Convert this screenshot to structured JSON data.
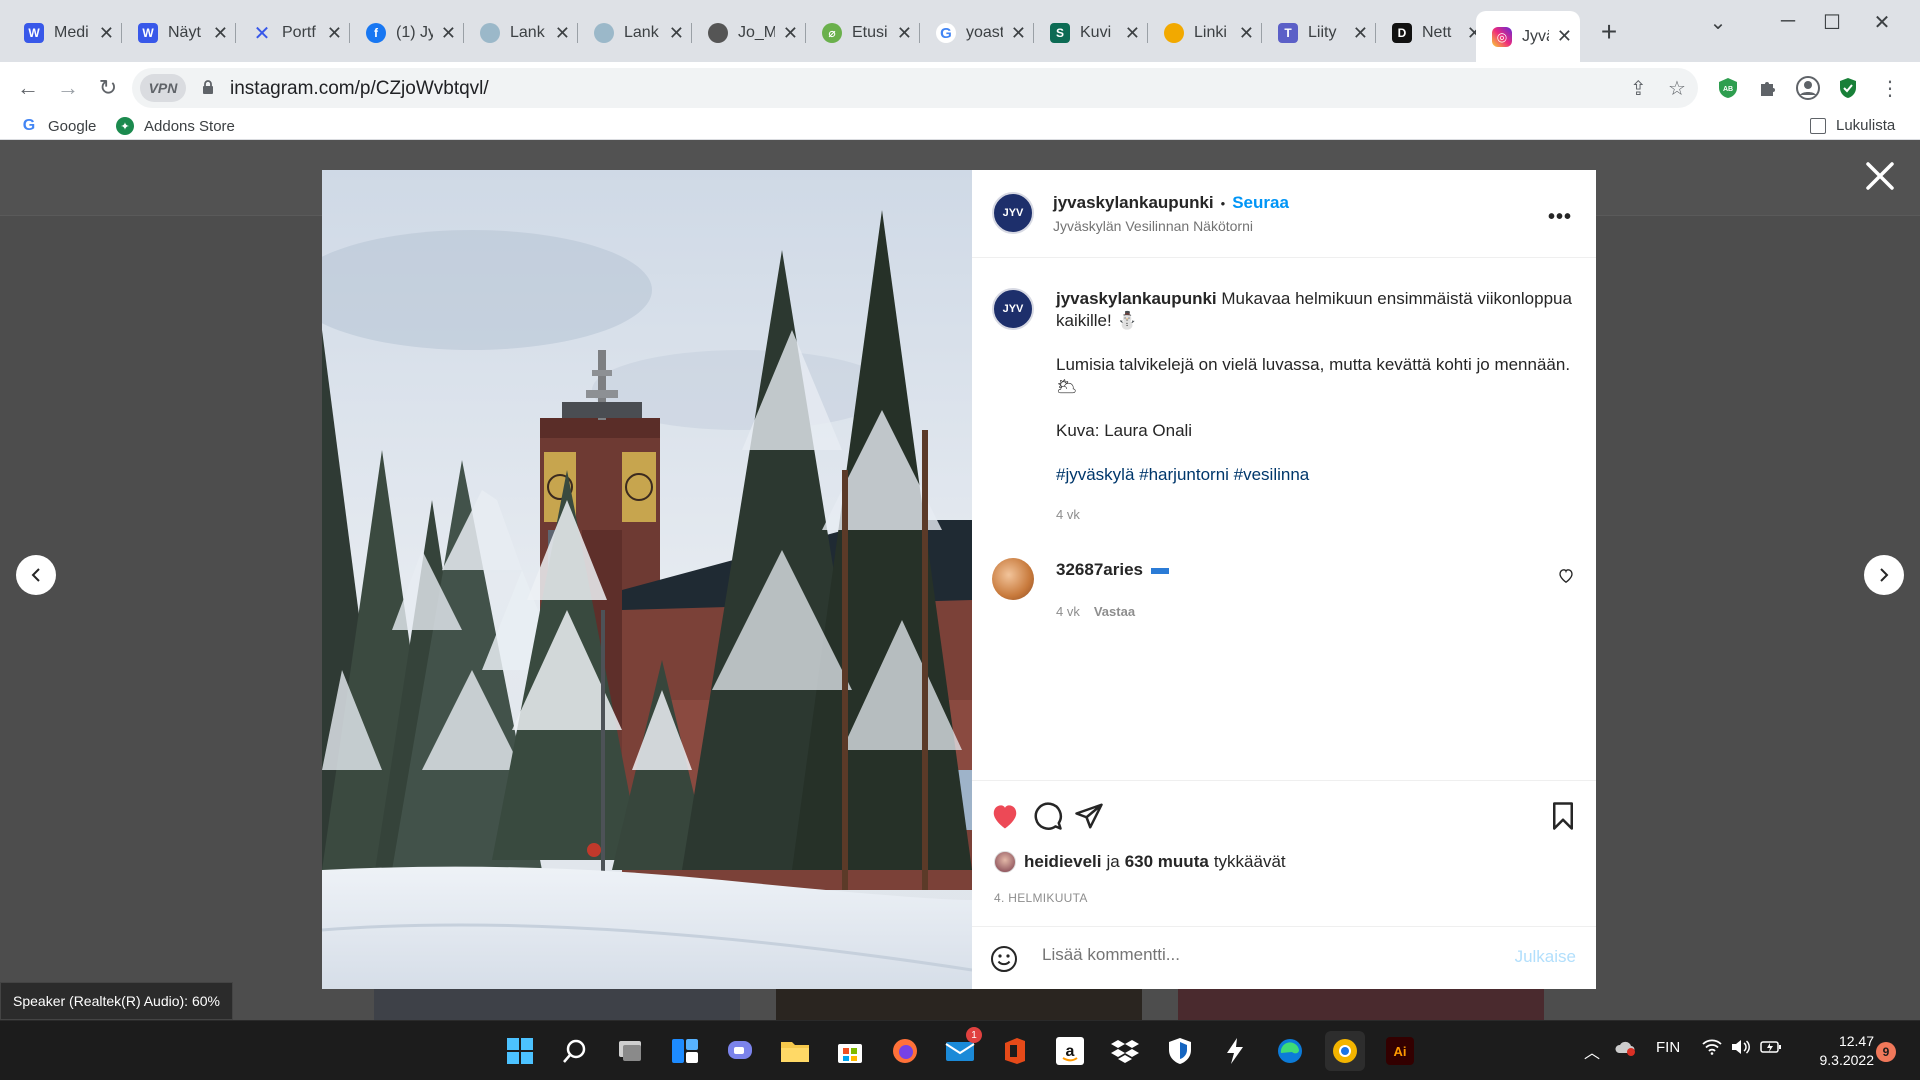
{
  "browser": {
    "tabs": [
      {
        "title": "Medi",
        "icon": "wordpress-icon",
        "color": "#3858e9"
      },
      {
        "title": "Näyt",
        "icon": "wordpress-icon",
        "color": "#3858e9"
      },
      {
        "title": "Portf",
        "icon": "x-logo-icon",
        "color": "#3858e9"
      },
      {
        "title": "(1) Jy",
        "icon": "facebook-icon",
        "color": "#1877f2"
      },
      {
        "title": "Lank",
        "icon": "globe-icon",
        "color": "#7aa874"
      },
      {
        "title": "Lank",
        "icon": "globe-icon",
        "color": "#7aa874"
      },
      {
        "title": "Jo_M",
        "icon": "avatar-icon",
        "color": "#444444"
      },
      {
        "title": "Etusi",
        "icon": "leaf-icon",
        "color": "#6ab04c"
      },
      {
        "title": "yoast",
        "icon": "google-icon",
        "color": "#4285f4"
      },
      {
        "title": "Kuvi",
        "icon": "s-logo-icon",
        "color": "#0c6b54"
      },
      {
        "title": "Linki",
        "icon": "link-icon",
        "color": "#f2a900"
      },
      {
        "title": "Liity",
        "icon": "teams-icon",
        "color": "#5b5fc7"
      },
      {
        "title": "Nett",
        "icon": "d-logo-icon",
        "color": "#111111"
      },
      {
        "title": "Jyväs",
        "icon": "instagram-icon",
        "color": "#d6249f",
        "active": true
      }
    ],
    "url": "instagram.com/p/CZjoWvbtqvl/",
    "vpn_label": "VPN",
    "bookmarks": [
      {
        "label": "Google",
        "icon": "google-icon"
      },
      {
        "label": "Addons Store",
        "icon": "addons-store-icon"
      }
    ],
    "reading_list": "Lukulista"
  },
  "post": {
    "username": "jyvaskylankaupunki",
    "bullet": "•",
    "follow_label": "Seuraa",
    "location": "Jyväskylän Vesilinnan Näkötorni",
    "avatar_text": "JYV",
    "caption_text": "Mukavaa helmikuun ensimmäistä viikonloppua kaikille! ⛄",
    "caption_line2": "Lumisia talvikelejä on vielä luvassa, mutta kevättä kohti jo mennään. 🌥",
    "caption_credit": "Kuva: Laura Onali",
    "hashtags": "#jyväskylä #harjuntorni #vesilinna",
    "caption_age": "4 vk",
    "comment": {
      "username": "32687aries",
      "age": "4 vk",
      "reply_label": "Vastaa"
    },
    "likes": {
      "first_user": "heidieveli",
      "connector": "ja",
      "count_text": "630 muuta",
      "suffix": "tykkäävät"
    },
    "date": "4. HELMIKUUTA",
    "comment_placeholder": "Lisää kommentti...",
    "publish_label": "Julkaise"
  },
  "speaker_tooltip": "Speaker (Realtek(R) Audio): 60%",
  "taskbar": {
    "mail_badge": "1",
    "lang": "FIN",
    "time": "12.47",
    "date": "9.3.2022",
    "notifications": "9"
  },
  "colors": {
    "instagram_blue": "#0095f6",
    "like_red": "#ed4956",
    "taskbar": "#1c1c1c"
  }
}
